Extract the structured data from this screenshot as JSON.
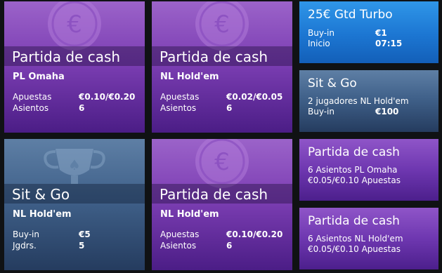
{
  "tiles": {
    "cash1": {
      "title": "Partida de cash",
      "game": "PL Omaha",
      "rows": [
        {
          "label": "Apuestas",
          "value": "€0.10/€0.20"
        },
        {
          "label": "Asientos",
          "value": "6"
        }
      ],
      "icon": "euro-coin-icon"
    },
    "cash2": {
      "title": "Partida de cash",
      "game": "NL Hold'em",
      "rows": [
        {
          "label": "Apuestas",
          "value": "€0.02/€0.05"
        },
        {
          "label": "Asientos",
          "value": "6"
        }
      ],
      "icon": "euro-coin-icon"
    },
    "sitgo1": {
      "title": "Sit & Go",
      "game": "NL Hold'em",
      "rows": [
        {
          "label": "Buy-in",
          "value": "€5"
        },
        {
          "label": "Jgdrs.",
          "value": "5"
        }
      ],
      "icon": "trophy-icon"
    },
    "cash3": {
      "title": "Partida de cash",
      "game": "NL Hold'em",
      "rows": [
        {
          "label": "Apuestas",
          "value": "€0.10/€0.20"
        },
        {
          "label": "Asientos",
          "value": "6"
        }
      ],
      "icon": "euro-coin-icon"
    },
    "turbo": {
      "title": "25€ Gtd Turbo",
      "rows": [
        {
          "label": "Buy-in",
          "value": "€1"
        },
        {
          "label": "Inicio",
          "value": "07:15"
        }
      ]
    },
    "sitgo2": {
      "title": "Sit & Go",
      "line1": "2 jugadores NL Hold'em",
      "rows": [
        {
          "label": "Buy-in",
          "value": "€100"
        }
      ]
    },
    "cash4": {
      "title": "Partida de cash",
      "line1": "6 Asientos PL Omaha",
      "line2": "€0.05/€0.10 Apuestas"
    },
    "cash5": {
      "title": "Partida de cash",
      "line1": "6 Asientos NL Hold'em",
      "line2": "€0.05/€0.10 Apuestas"
    }
  },
  "colors": {
    "background": "#101214",
    "purple": "#7d3fb4",
    "steel": "#40618a",
    "blue": "#1c76d2"
  }
}
